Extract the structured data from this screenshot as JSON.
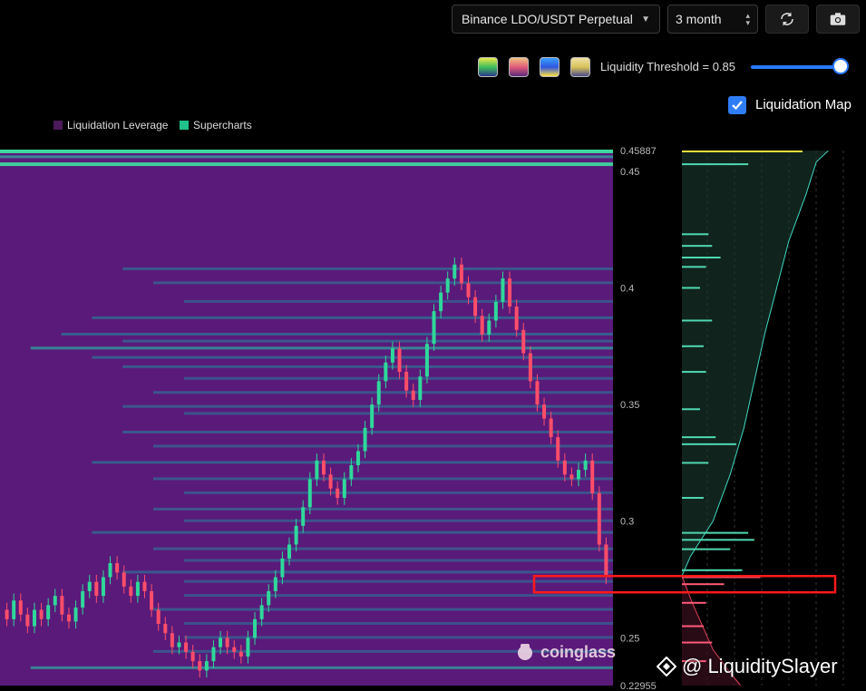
{
  "toolbar": {
    "pair": "Binance LDO/USDT Perpetual",
    "range": "3 month",
    "threshold_label": "Liquidity Threshold = 0.85",
    "threshold_value": 0.85,
    "liquidation_map_label": "Liquidation Map",
    "liquidation_map_checked": true,
    "palettes": [
      "#3fbf5a",
      "#e05a7a",
      "#2f56e0",
      "#d8c25a"
    ]
  },
  "legend": [
    {
      "label": "Liquidation Leverage",
      "color": "#4a1a5a"
    },
    {
      "label": "Supercharts",
      "color": "#1fc28a"
    }
  ],
  "watermark": "coinglass",
  "credit": "@ LiquiditySlayer",
  "chart_data": {
    "type": "heatmap",
    "title": "",
    "ylim": [
      0.22955,
      0.45887
    ],
    "y_ticks": [
      "0.45887",
      "0.45",
      "0.4",
      "0.35",
      "0.3",
      "0.25",
      "0.22955"
    ],
    "y_tick_values": [
      0.45887,
      0.45,
      0.4,
      0.35,
      0.3,
      0.25,
      0.22955
    ],
    "background_color": "#5a1a7a",
    "bands": [
      {
        "price": 0.4585,
        "strength": 1.0
      },
      {
        "price": 0.456,
        "strength": 0.6
      },
      {
        "price": 0.453,
        "strength": 0.9
      },
      {
        "price": 0.408,
        "strength": 0.4
      },
      {
        "price": 0.402,
        "strength": 0.35
      },
      {
        "price": 0.394,
        "strength": 0.3
      },
      {
        "price": 0.387,
        "strength": 0.45
      },
      {
        "price": 0.38,
        "strength": 0.5
      },
      {
        "price": 0.377,
        "strength": 0.4
      },
      {
        "price": 0.374,
        "strength": 0.55
      },
      {
        "price": 0.37,
        "strength": 0.45
      },
      {
        "price": 0.366,
        "strength": 0.4
      },
      {
        "price": 0.361,
        "strength": 0.3
      },
      {
        "price": 0.355,
        "strength": 0.35
      },
      {
        "price": 0.349,
        "strength": 0.4
      },
      {
        "price": 0.346,
        "strength": 0.3
      },
      {
        "price": 0.338,
        "strength": 0.4
      },
      {
        "price": 0.332,
        "strength": 0.35
      },
      {
        "price": 0.325,
        "strength": 0.45
      },
      {
        "price": 0.318,
        "strength": 0.35
      },
      {
        "price": 0.312,
        "strength": 0.3
      },
      {
        "price": 0.305,
        "strength": 0.35
      },
      {
        "price": 0.3,
        "strength": 0.3
      },
      {
        "price": 0.295,
        "strength": 0.45
      },
      {
        "price": 0.288,
        "strength": 0.35
      },
      {
        "price": 0.283,
        "strength": 0.3
      },
      {
        "price": 0.278,
        "strength": 0.4
      },
      {
        "price": 0.274,
        "strength": 0.3
      },
      {
        "price": 0.268,
        "strength": 0.3
      },
      {
        "price": 0.262,
        "strength": 0.35
      },
      {
        "price": 0.256,
        "strength": 0.3
      },
      {
        "price": 0.25,
        "strength": 0.3
      },
      {
        "price": 0.244,
        "strength": 0.35
      },
      {
        "price": 0.237,
        "strength": 0.55
      }
    ],
    "price_series": [
      0.262,
      0.258,
      0.266,
      0.26,
      0.255,
      0.262,
      0.258,
      0.264,
      0.268,
      0.26,
      0.257,
      0.263,
      0.27,
      0.274,
      0.268,
      0.276,
      0.282,
      0.278,
      0.272,
      0.268,
      0.274,
      0.27,
      0.262,
      0.256,
      0.252,
      0.246,
      0.248,
      0.244,
      0.24,
      0.236,
      0.24,
      0.246,
      0.25,
      0.246,
      0.244,
      0.242,
      0.25,
      0.258,
      0.264,
      0.27,
      0.276,
      0.284,
      0.29,
      0.298,
      0.306,
      0.318,
      0.326,
      0.32,
      0.314,
      0.31,
      0.318,
      0.324,
      0.33,
      0.34,
      0.35,
      0.36,
      0.368,
      0.374,
      0.364,
      0.356,
      0.352,
      0.362,
      0.376,
      0.39,
      0.398,
      0.404,
      0.41,
      0.402,
      0.396,
      0.388,
      0.38,
      0.386,
      0.394,
      0.404,
      0.392,
      0.382,
      0.372,
      0.36,
      0.35,
      0.344,
      0.336,
      0.326,
      0.32,
      0.318,
      0.322,
      0.326,
      0.312,
      0.29,
      0.276
    ],
    "price_x_range": [
      0,
      676
    ],
    "highlight": {
      "price_top": 0.2765,
      "price_bottom": 0.2695,
      "color": "#ff1a1a"
    },
    "liquidation_map": {
      "bars": [
        {
          "price": 0.4585,
          "value": 1.0
        },
        {
          "price": 0.453,
          "value": 0.55
        },
        {
          "price": 0.423,
          "value": 0.22
        },
        {
          "price": 0.418,
          "value": 0.25
        },
        {
          "price": 0.413,
          "value": 0.32
        },
        {
          "price": 0.409,
          "value": 0.2
        },
        {
          "price": 0.4,
          "value": 0.15
        },
        {
          "price": 0.386,
          "value": 0.25
        },
        {
          "price": 0.375,
          "value": 0.18
        },
        {
          "price": 0.364,
          "value": 0.2
        },
        {
          "price": 0.348,
          "value": 0.15
        },
        {
          "price": 0.336,
          "value": 0.28
        },
        {
          "price": 0.333,
          "value": 0.45
        },
        {
          "price": 0.325,
          "value": 0.22
        },
        {
          "price": 0.31,
          "value": 0.18
        },
        {
          "price": 0.295,
          "value": 0.55
        },
        {
          "price": 0.292,
          "value": 0.6
        },
        {
          "price": 0.288,
          "value": 0.4
        },
        {
          "price": 0.279,
          "value": 0.5
        },
        {
          "price": 0.276,
          "value": 0.65
        },
        {
          "price": 0.273,
          "value": 0.35
        },
        {
          "price": 0.265,
          "value": 0.2
        },
        {
          "price": 0.255,
          "value": 0.18
        },
        {
          "price": 0.248,
          "value": 0.25
        },
        {
          "price": 0.24,
          "value": 0.2
        }
      ],
      "cumulative_up": [
        [
          0.4588,
          0.85
        ],
        [
          0.454,
          0.78
        ],
        [
          0.44,
          0.72
        ],
        [
          0.42,
          0.62
        ],
        [
          0.4,
          0.55
        ],
        [
          0.38,
          0.48
        ],
        [
          0.36,
          0.42
        ],
        [
          0.34,
          0.36
        ],
        [
          0.32,
          0.28
        ],
        [
          0.3,
          0.18
        ],
        [
          0.285,
          0.05
        ],
        [
          0.2765,
          0.0
        ]
      ],
      "cumulative_down": [
        [
          0.2765,
          0.0
        ],
        [
          0.265,
          0.06
        ],
        [
          0.255,
          0.12
        ],
        [
          0.245,
          0.18
        ],
        [
          0.235,
          0.28
        ],
        [
          0.2296,
          0.34
        ]
      ]
    }
  }
}
